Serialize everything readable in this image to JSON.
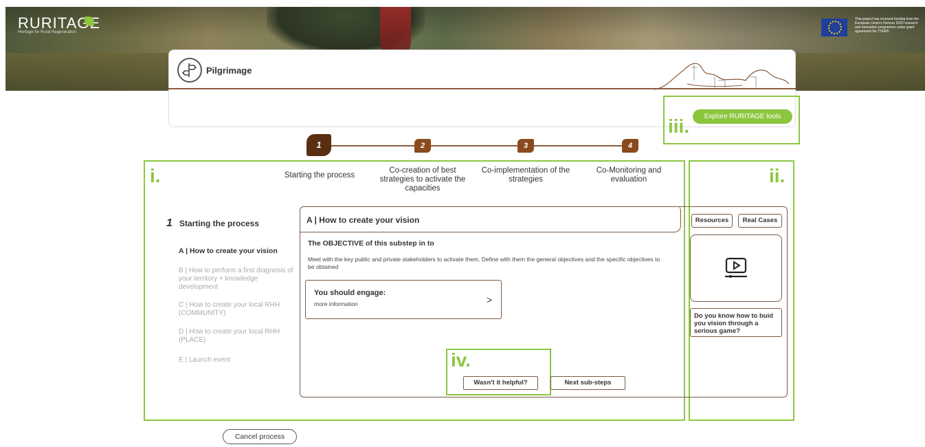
{
  "header": {
    "logo_text": "RURITAGE",
    "logo_subtitle": "Heritage for Rural Regeneration",
    "eu_notice": "This project has received funding from the European Union's Horizon 2020 research and innovation programme under grant agreement No 776465"
  },
  "page": {
    "title": "Pilgrimage",
    "explore_button": "Explore RURITAGE tools"
  },
  "annotations": {
    "i": "i.",
    "ii": "ii.",
    "iii": "iii.",
    "iv": "iv."
  },
  "steps": [
    {
      "num": "1",
      "label": "Starting the process"
    },
    {
      "num": "2",
      "label": "Co-creation of best strategies to activate the capacities"
    },
    {
      "num": "3",
      "label": "Co-implementation of the strategies"
    },
    {
      "num": "4",
      "label": "Co-Monitoring and evaluation"
    }
  ],
  "nav": {
    "step_num": "1",
    "title": "Starting the process",
    "items": [
      "A | How to create your vision",
      "B | How to perform a first diagnosis of your territory + knowledge development",
      "C | How to create your local RHH (COMMUNITY)",
      "D | How to create your local RHH (PLACE)",
      "E | Launch event"
    ]
  },
  "content": {
    "title": "A | How to create your vision",
    "objective_title": "The OBJECTIVE of this substep in to",
    "objective_text": "Meet with the key public and private stakeholders to activate them. Define with them the general objectives and the specific objectives to be obtained",
    "engage_title": "You should engage:",
    "engage_sub": "more information",
    "engage_arrow": ">",
    "helpful_button": "Wasn't it helpful?",
    "next_button": "Next sub-steps"
  },
  "sidebar": {
    "resources_button": "Resources",
    "real_cases_button": "Real Cases",
    "question": "Do you know how to buid you vision through a serious game?"
  },
  "footer": {
    "cancel_button": "Cancel process"
  },
  "colors": {
    "accent_green": "#8cc63f",
    "brown": "#7a5a44",
    "step_brown": "#8a4a1e"
  }
}
